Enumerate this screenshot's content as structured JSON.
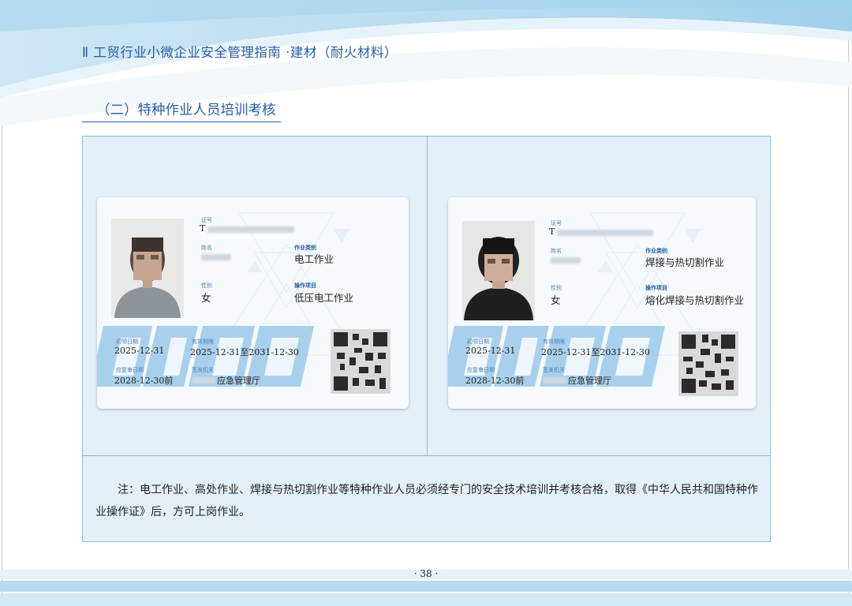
{
  "header": {
    "running_title": "Ⅱ 工贸行业小微企业安全管理指南 ·建材（耐火材料）"
  },
  "section": {
    "title": "（二）特种作业人员培训考核"
  },
  "cards": [
    {
      "labels": {
        "cert_no": "证号",
        "name": "姓名",
        "gender": "性别",
        "category": "作业类别",
        "item": "操作项目",
        "first_issue": "初领日期",
        "valid": "有效期限",
        "review": "应复审日期",
        "issuer": "签发机关"
      },
      "cert_no_prefix": "T",
      "gender": "女",
      "category": "电工作业",
      "item": "低压电工作业",
      "first_issue_date": "2025-12-31",
      "valid_period": "2025-12-31至2031-12-30",
      "review_date": "2028-12-30前",
      "issuer": "应急管理厅"
    },
    {
      "labels": {
        "cert_no": "证号",
        "name": "姓名",
        "gender": "性别",
        "category": "作业类别",
        "item": "操作项目",
        "first_issue": "初领日期",
        "valid": "有效期限",
        "review": "应复审日期",
        "issuer": "签发机关"
      },
      "cert_no_prefix": "T",
      "gender": "女",
      "category": "焊接与热切割作业",
      "item": "熔化焊接与热切割作业",
      "first_issue_date": "2025-12-31",
      "valid_period": "2025-12-31至2031-12-30",
      "review_date": "2028-12-30前",
      "issuer": "应急管理厅"
    }
  ],
  "note": {
    "text": "注：电工作业、高处作业、焊接与热切割作业等特种作业人员必须经专门的安全技术培训并考核合格，取得《中华人民共和国特种作业操作证》后，方可上岗作业。"
  },
  "footer": {
    "page_number": "· 38 ·"
  },
  "colors": {
    "accent": "#2a5fa8",
    "box_fill": "#e3f0fa",
    "box_border": "#8fb7dc",
    "band": "#b7dcef"
  }
}
